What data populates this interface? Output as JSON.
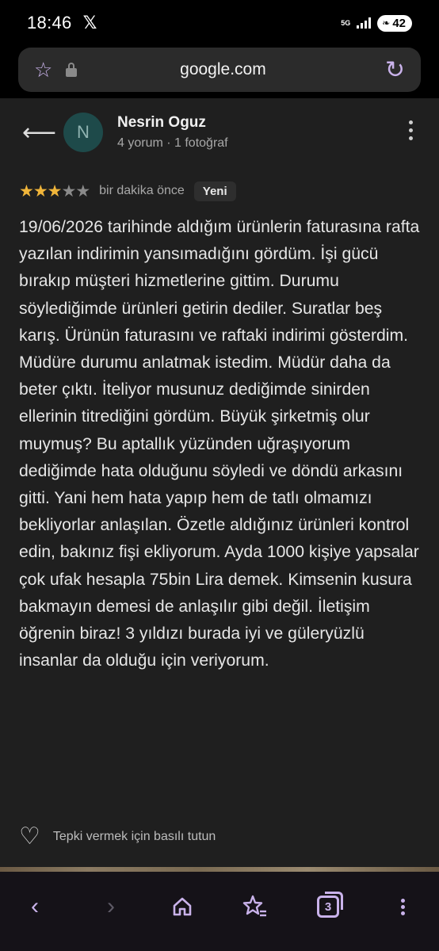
{
  "status_bar": {
    "time": "18:46",
    "x_logo": "𝕏",
    "network": "5G",
    "battery": "42"
  },
  "browser": {
    "url": "google.com",
    "accent_color": "#c9b2ea"
  },
  "review": {
    "reviewer_initial": "N",
    "reviewer_name": "Nesrin Oguz",
    "reviewer_meta": "4 yorum · 1 fotoğraf",
    "rating": 3,
    "max_rating": 5,
    "time_ago": "bir dakika önce",
    "badge": "Yeni",
    "text": "19/06/2026 tarihinde aldığım ürünlerin faturasına rafta yazılan indirimin yansımadığını gördüm. İşi gücü bırakıp müşteri hizmetlerine gittim. Durumu söylediğimde ürünleri getirin dediler. Suratlar beş karış. Ürünün faturasını ve raftaki indirimi gösterdim. Müdüre durumu anlatmak istedim. Müdür daha da beter çıktı. İteliyor musunuz dediğimde sinirden ellerinin titrediğini gördüm. Büyük şirketmiş olur muymuş? Bu aptallık yüzünden uğraşıyorum dediğimde hata olduğunu söyledi ve döndü arkasını gitti. Yani hem hata yapıp hem de tatlı olmamızı bekliyorlar anlaşılan. Özetle aldığınız ürünleri kontrol edin, bakınız fişi ekliyorum. Ayda 1000 kişiye yapsalar çok ufak hesapla 75bin Lira demek. Kimsenin kusura bakmayın demesi de anlaşılır gibi değil. İletişim öğrenin biraz! 3 yıldızı burada iyi ve güleryüzlü insanlar da olduğu için veriyorum.",
    "react_hint": "Tepki vermek için basılı tutun"
  },
  "bottom_nav": {
    "tab_count": "3"
  },
  "icons": {
    "back": "arrow-left-icon",
    "more": "kebab-menu-icon",
    "bookmark": "star-outline-icon",
    "lock": "lock-icon",
    "reload": "reload-icon",
    "heart": "heart-outline-icon",
    "home": "home-icon",
    "bookmarks": "star-list-icon",
    "tabs": "tabs-icon",
    "menu": "vertical-dots-icon"
  }
}
